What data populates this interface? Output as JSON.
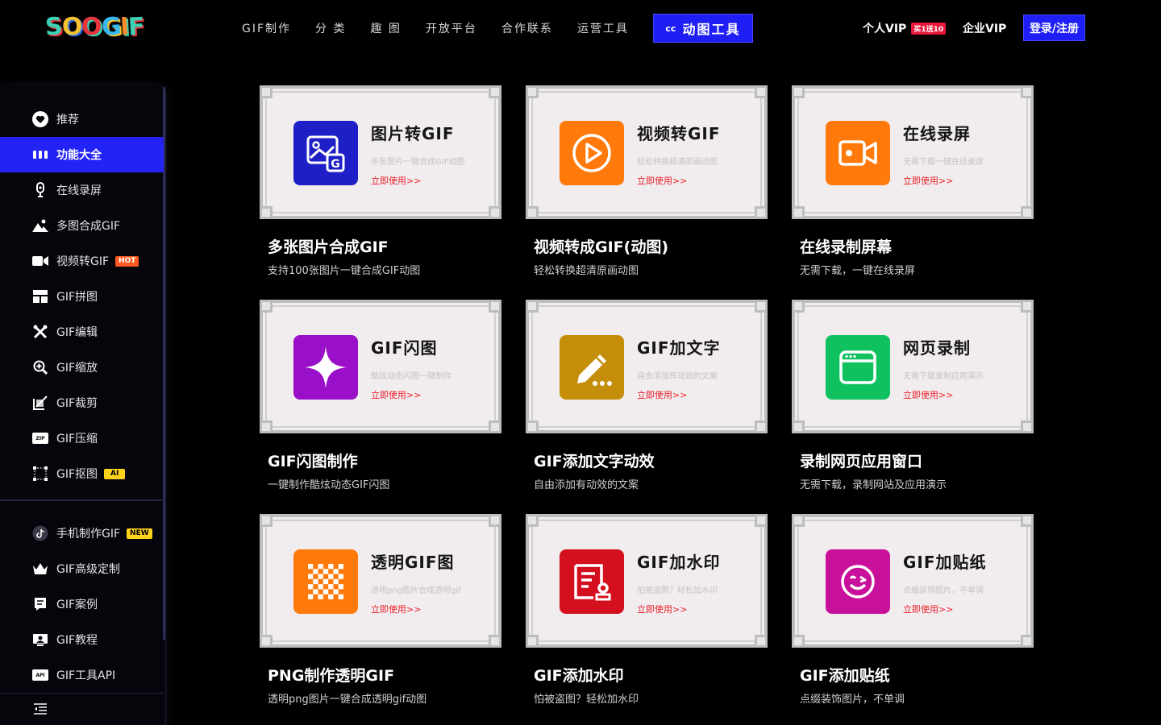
{
  "header": {
    "logo": [
      "S",
      "O",
      "O",
      "G",
      "I",
      "F"
    ],
    "nav": [
      "GIF制作",
      "分 类",
      "趣 图",
      "开放平台",
      "合作联系",
      "运营工具"
    ],
    "tool_icon": "cc",
    "tool_label": "动图工具",
    "vip_personal": "个人VIP",
    "vip_badge": "买1送10",
    "vip_enterprise": "企业VIP",
    "login": "登录/注册"
  },
  "sidebar": {
    "items": [
      {
        "label": "推荐",
        "icon": "heart-icon"
      },
      {
        "label": "功能大全",
        "icon": "grid-icon"
      },
      {
        "label": "在线录屏",
        "icon": "mic-icon"
      },
      {
        "label": "多图合成GIF",
        "icon": "mountain-icon"
      },
      {
        "label": "视频转GIF",
        "icon": "video-icon",
        "tag": "HOT"
      },
      {
        "label": "GIF拼图",
        "icon": "layout-icon"
      },
      {
        "label": "GIF编辑",
        "icon": "tools-icon"
      },
      {
        "label": "GIF缩放",
        "icon": "zoom-icon"
      },
      {
        "label": "GIF裁剪",
        "icon": "crop-icon"
      },
      {
        "label": "GIF压缩",
        "icon": "zip-icon",
        "icon_text": "ZIP"
      },
      {
        "label": "GIF抠图",
        "icon": "matting-icon",
        "tag": "AI"
      }
    ],
    "items2": [
      {
        "label": "手机制作GIF",
        "icon": "tiktok-icon",
        "tag": "NEW"
      },
      {
        "label": "GIF高级定制",
        "icon": "crown-icon"
      },
      {
        "label": "GIF案例",
        "icon": "case-icon"
      },
      {
        "label": "GIF教程",
        "icon": "tutorial-icon"
      },
      {
        "label": "GIF工具API",
        "icon": "api-icon",
        "icon_text": "API"
      }
    ]
  },
  "cards": [
    {
      "inner_title": "图片转GIF",
      "inner_desc": "多张图片一键合成GIF动图",
      "link": "立即使用>>",
      "title": "多张图片合成GIF",
      "desc": "支持100张图片一键合成GIF动图",
      "color": "#1f1fc8",
      "icon": "image-gif-icon"
    },
    {
      "inner_title": "视频转GIF",
      "inner_desc": "轻松转换超清原画动图",
      "link": "立即使用>>",
      "title": "视频转成GIF(动图)",
      "desc": "轻松转换超清原画动图",
      "color": "#ff7a0b",
      "icon": "play-icon"
    },
    {
      "inner_title": "在线录屏",
      "inner_desc": "无需下载一键在线录屏",
      "link": "立即使用>>",
      "title": "在线录制屏幕",
      "desc": "无需下载，一键在线录屏",
      "color": "#ff7a0b",
      "icon": "camera-icon"
    },
    {
      "inner_title": "GIF闪图",
      "inner_desc": "酷炫动态闪图一键制作",
      "link": "立即使用>>",
      "title": "GIF闪图制作",
      "desc": "一键制作酷炫动态GIF闪图",
      "color": "#9a10c8",
      "icon": "sparkle-icon"
    },
    {
      "inner_title": "GIF加文字",
      "inner_desc": "自由添加有动效的文案",
      "link": "立即使用>>",
      "title": "GIF添加文字动效",
      "desc": "自由添加有动效的文案",
      "color": "#c48e0a",
      "icon": "pencil-icon"
    },
    {
      "inner_title": "网页录制",
      "inner_desc": "无需下载录制应用演示",
      "link": "立即使用>>",
      "title": "录制网页应用窗口",
      "desc": "无需下载，录制网站及应用演示",
      "color": "#10c160",
      "icon": "browser-icon"
    },
    {
      "inner_title": "透明GIF图",
      "inner_desc": "透明png图片合成透明gif",
      "link": "立即使用>>",
      "title": "PNG制作透明GIF",
      "desc": "透明png图片一键合成透明gif动图",
      "color": "#ff7a0b",
      "icon": "checker-icon"
    },
    {
      "inner_title": "GIF加水印",
      "inner_desc": "怕被盗图？轻松加水印",
      "link": "立即使用>>",
      "title": "GIF添加水印",
      "desc": "怕被盗图？轻松加水印",
      "color": "#d4101e",
      "icon": "watermark-icon"
    },
    {
      "inner_title": "GIF加贴纸",
      "inner_desc": "点缀装饰图片，不单调",
      "link": "立即使用>>",
      "title": "GIF添加贴纸",
      "desc": "点缀装饰图片，不单调",
      "color": "#c8109a",
      "icon": "sticker-icon"
    }
  ]
}
